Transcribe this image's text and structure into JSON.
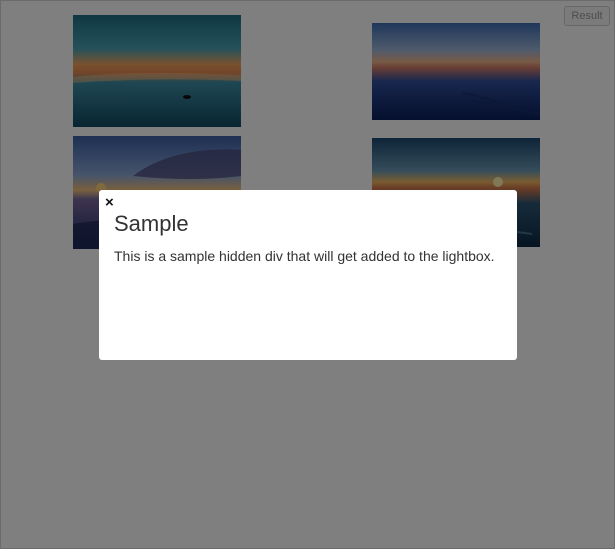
{
  "toolbar": {
    "result_label": "Result"
  },
  "gallery": {
    "images": [
      {
        "name": "beach-sunset-image-1"
      },
      {
        "name": "beach-sunset-image-2"
      },
      {
        "name": "beach-sunset-image-3"
      },
      {
        "name": "beach-sunset-image-4"
      }
    ]
  },
  "lightbox": {
    "close_label": "×",
    "title": "Sample",
    "text": "This is a sample hidden div that will get added to the lightbox."
  },
  "colors": {
    "overlay": "rgba(0,0,0,0.5)",
    "lightbox_background": "#ffffff",
    "text": "#333333"
  }
}
